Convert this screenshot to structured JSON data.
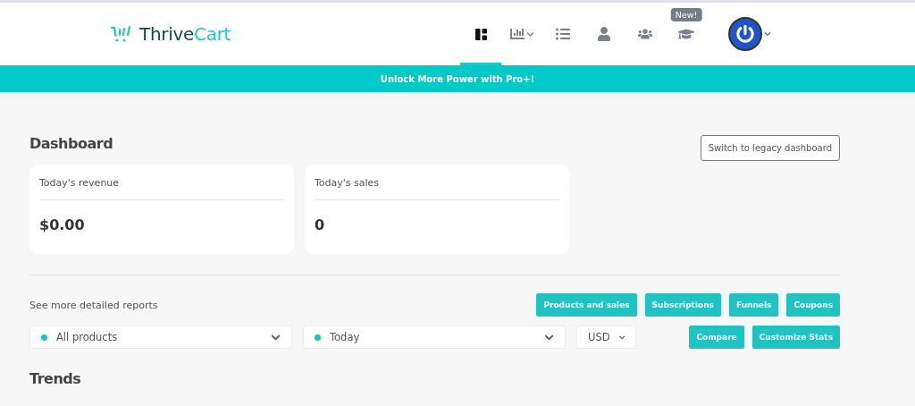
{
  "logo": {
    "parts": [
      "Thrive",
      "Cart"
    ]
  },
  "nav": [
    {
      "kind": "dashboard",
      "selected": true
    },
    {
      "kind": "chart",
      "selected": false
    },
    {
      "kind": "list",
      "selected": false
    },
    {
      "kind": "user",
      "selected": false
    },
    {
      "kind": "team",
      "selected": false
    },
    {
      "kind": "course",
      "selected": false,
      "badge": "New!"
    }
  ],
  "banner": "Unlock More Power with Pro+!",
  "page_title": "Dashboard",
  "legacy_button": "Switch to legacy dashboard",
  "stats": [
    {
      "label": "Today's revenue",
      "value": "$0.00"
    },
    {
      "label": "Today's sales",
      "value": "0"
    }
  ],
  "reports_label": "See more detailed reports",
  "report_buttons": [
    "Products and sales",
    "Subscriptions",
    "Funnels",
    "Coupons"
  ],
  "filters": [
    {
      "kind": "dot",
      "value": "All products"
    },
    {
      "kind": "dot",
      "value": "Today"
    },
    {
      "kind": "plain",
      "value": "USD"
    }
  ],
  "action_buttons": [
    "Compare",
    "Customize Stats"
  ],
  "section_title": "Trends"
}
